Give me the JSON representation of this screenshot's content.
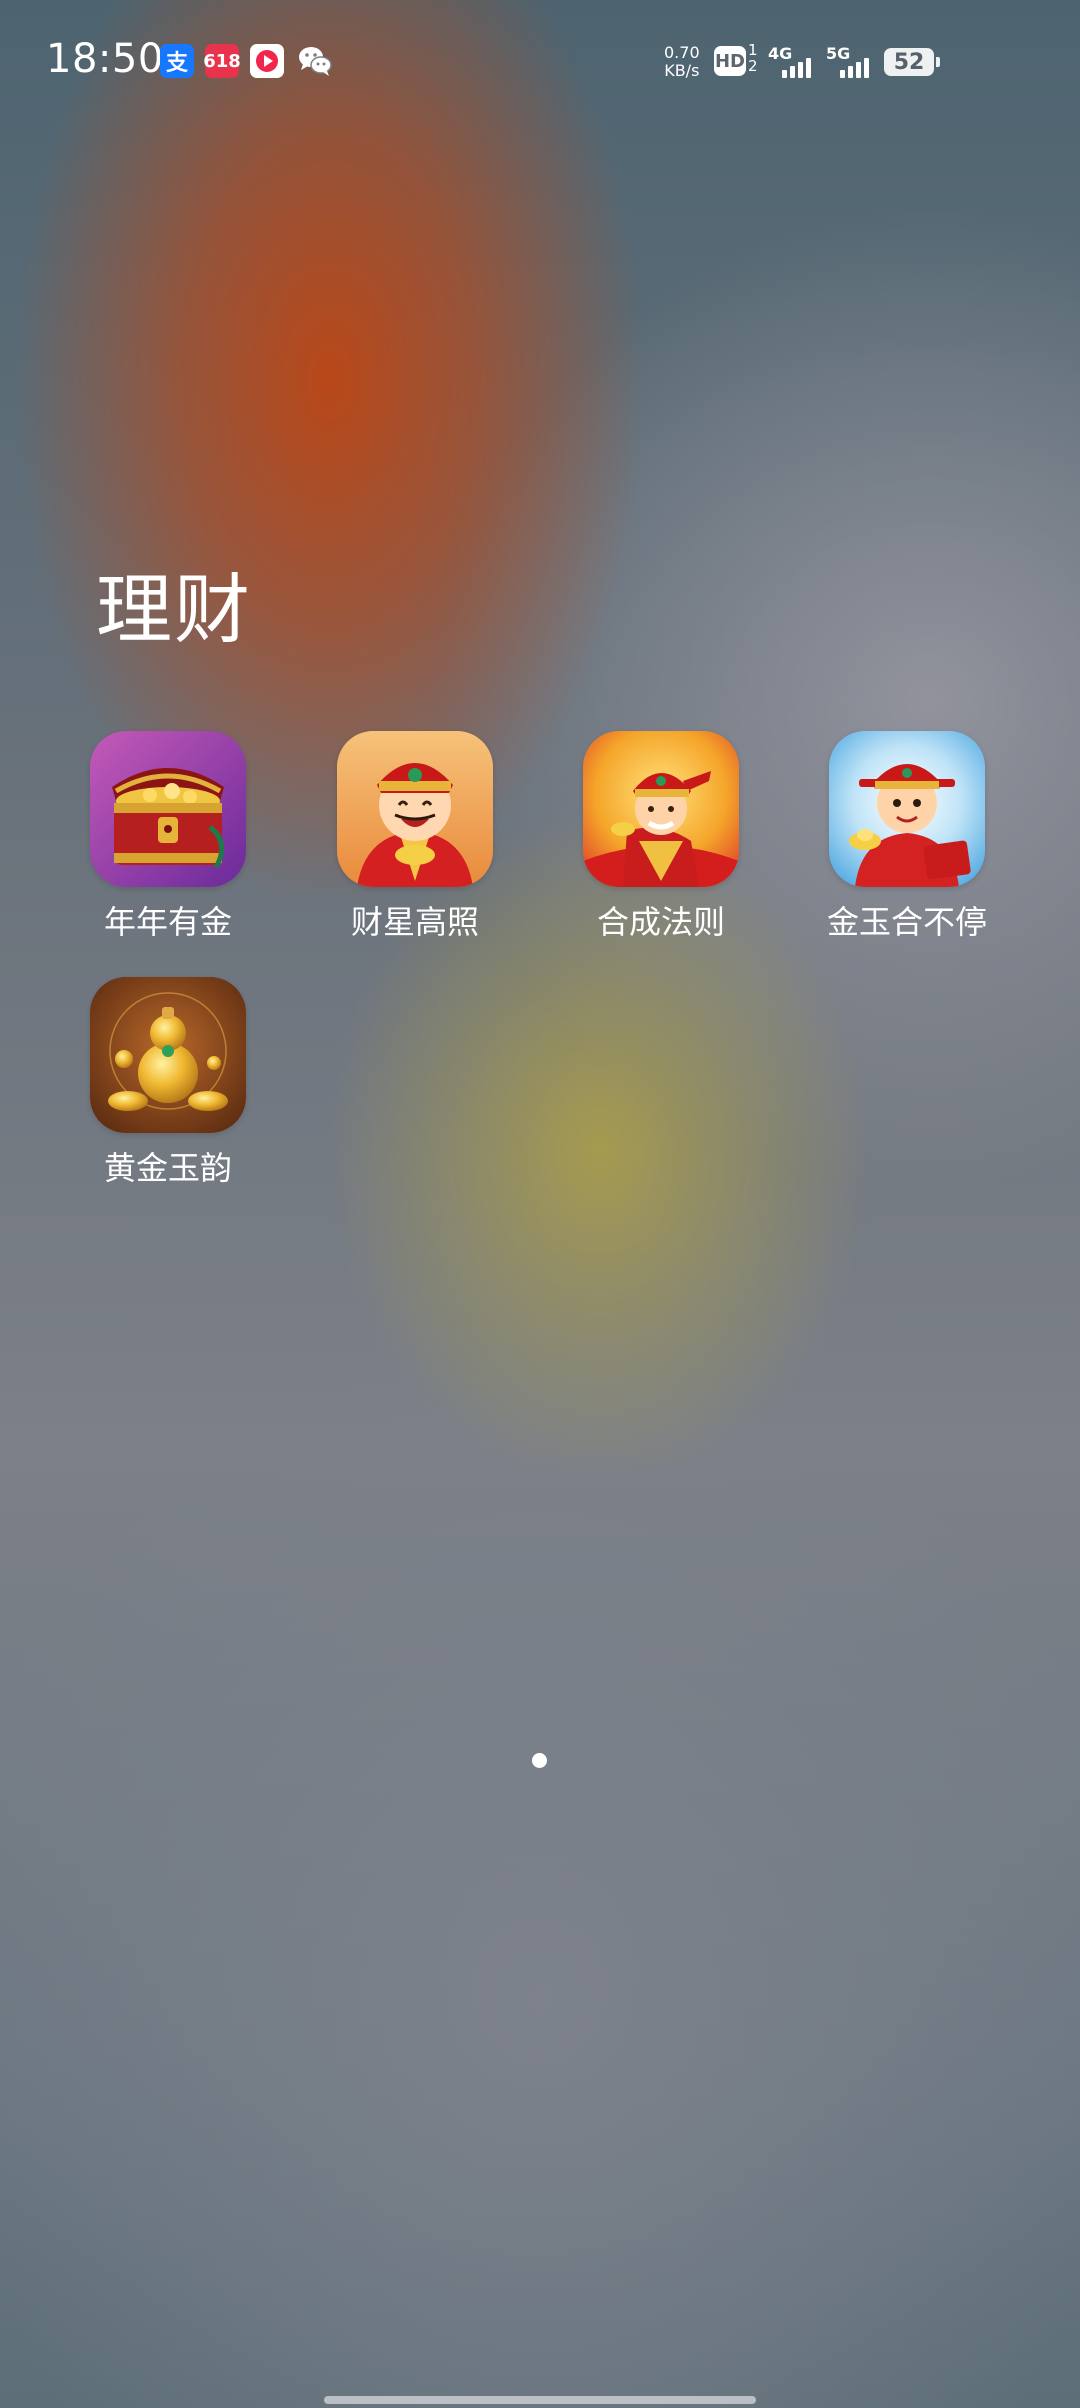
{
  "status_bar": {
    "time": "18:50",
    "notifications": [
      {
        "name": "alipay-icon",
        "glyph": "支"
      },
      {
        "name": "app-notification-icon",
        "glyph": "618"
      },
      {
        "name": "video-app-icon"
      },
      {
        "name": "wechat-icon"
      }
    ],
    "net_speed_value": "0.70",
    "net_speed_unit": "KB/s",
    "hd_label": "HD",
    "hd_sub_top": "1",
    "hd_sub_bottom": "2",
    "signal_4g_label": "4G",
    "signal_5g_label": "5G",
    "battery_level": "52"
  },
  "folder": {
    "title": "理财",
    "apps": [
      {
        "label": "年年有金",
        "icon": "treasure-chest-icon"
      },
      {
        "label": "财星高照",
        "icon": "god-of-wealth-icon"
      },
      {
        "label": "合成法则",
        "icon": "god-of-wealth-running-icon"
      },
      {
        "label": "金玉合不停",
        "icon": "boy-with-gold-ingot-icon"
      },
      {
        "label": "黄金玉韵",
        "icon": "golden-gourd-icon"
      }
    ]
  },
  "page_indicator": {
    "current": 1,
    "total": 1
  },
  "colors": {
    "wallpaper_orange": "#be4614",
    "wallpaper_gray": "#6b737c",
    "alipay_blue": "#1677ff",
    "text": "#ffffff"
  }
}
